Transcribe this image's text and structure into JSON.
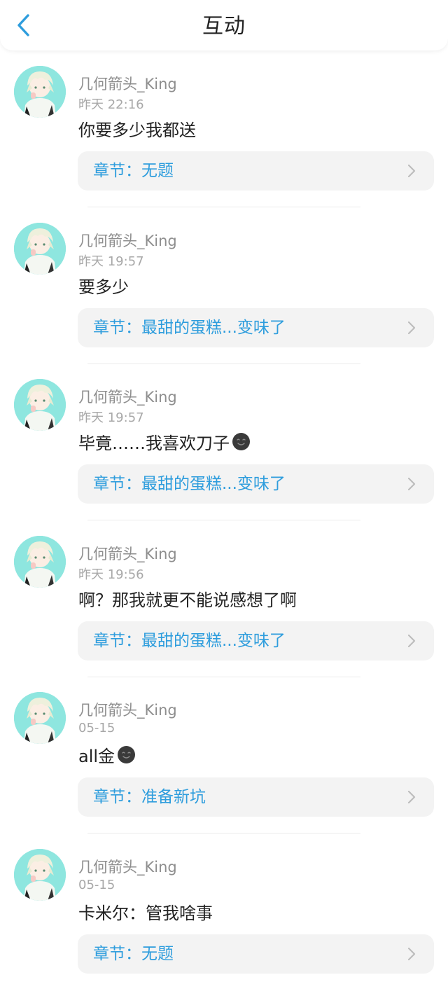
{
  "header": {
    "title": "互动"
  },
  "colors": {
    "accent": "#2e9ddd",
    "avatar_bg": "#8ee6df"
  },
  "feed": [
    {
      "username": "几何箭头_King",
      "time": "昨天 22:16",
      "text": "你要多少我都送",
      "emoji": false,
      "chapter": "章节：无题"
    },
    {
      "username": "几何箭头_King",
      "time": "昨天 19:57",
      "text": "要多少",
      "emoji": false,
      "chapter": "章节：最甜的蛋糕...变味了"
    },
    {
      "username": "几何箭头_King",
      "time": "昨天 19:57",
      "text": "毕竟……我喜欢刀子",
      "emoji": true,
      "chapter": "章节：最甜的蛋糕...变味了"
    },
    {
      "username": "几何箭头_King",
      "time": "昨天 19:56",
      "text": "啊？那我就更不能说感想了啊",
      "emoji": false,
      "chapter": "章节：最甜的蛋糕...变味了"
    },
    {
      "username": "几何箭头_King",
      "time": "05-15",
      "text": "all金",
      "emoji": true,
      "chapter": "章节：准备新坑"
    },
    {
      "username": "几何箭头_King",
      "time": "05-15",
      "text": "卡米尔：管我啥事",
      "emoji": false,
      "chapter": "章节：无题"
    }
  ]
}
